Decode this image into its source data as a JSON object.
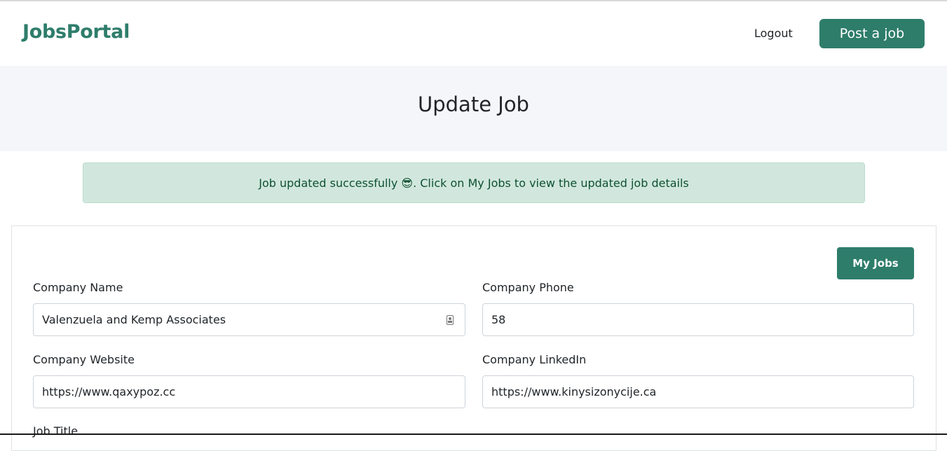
{
  "navbar": {
    "brand": "JobsPortal",
    "logout_label": "Logout",
    "post_job_label": "Post a job"
  },
  "page": {
    "title": "Update Job"
  },
  "alert": {
    "message": "Job updated successfully 😎. Click on My Jobs to view the updated job details"
  },
  "form": {
    "my_jobs_label": "My Jobs",
    "company_name": {
      "label": "Company Name",
      "value": "Valenzuela and Kemp Associates"
    },
    "company_phone": {
      "label": "Company Phone",
      "value": "58"
    },
    "company_website": {
      "label": "Company Website",
      "value": "https://www.qaxypoz.cc"
    },
    "company_linkedin": {
      "label": "Company LinkedIn",
      "value": "https://www.kinysizonycije.ca"
    },
    "job_title": {
      "label": "Job Title"
    }
  },
  "colors": {
    "brand": "#2e7d6b",
    "alert_bg": "#d1e7dd",
    "alert_text": "#0f5132",
    "hero_bg": "#f5f6fa"
  },
  "icons": {
    "autofill": "contact-card-icon"
  }
}
